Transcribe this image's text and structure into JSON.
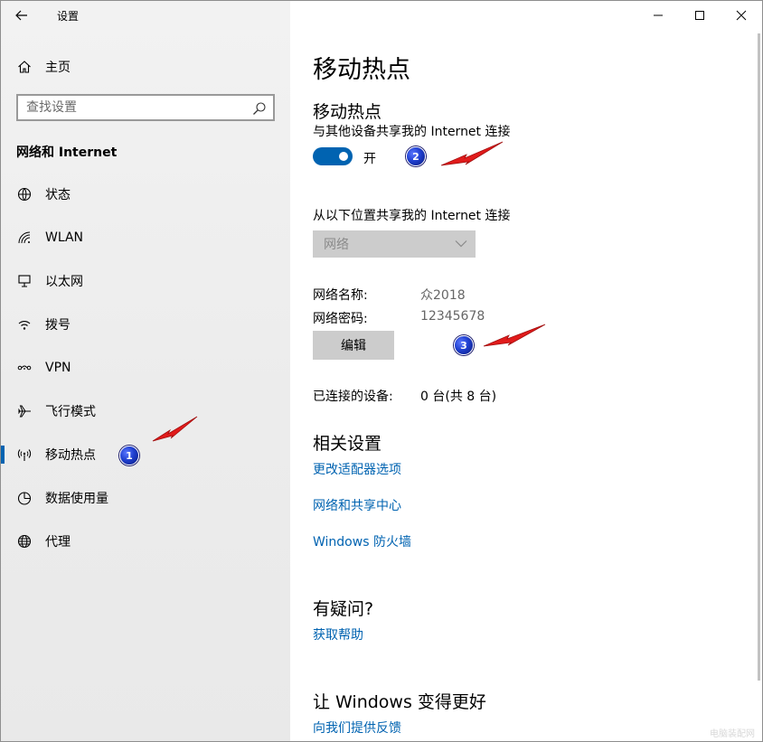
{
  "window": {
    "app_title": "设置"
  },
  "sidebar": {
    "home_label": "主页",
    "search_placeholder": "查找设置",
    "section_title": "网络和 Internet",
    "items": [
      {
        "label": "状态",
        "icon": "status-icon"
      },
      {
        "label": "WLAN",
        "icon": "wifi-icon"
      },
      {
        "label": "以太网",
        "icon": "ethernet-icon"
      },
      {
        "label": "拨号",
        "icon": "dialup-icon"
      },
      {
        "label": "VPN",
        "icon": "vpn-icon"
      },
      {
        "label": "飞行模式",
        "icon": "airplane-icon"
      },
      {
        "label": "移动热点",
        "icon": "hotspot-icon",
        "active": true
      },
      {
        "label": "数据使用量",
        "icon": "data-usage-icon"
      },
      {
        "label": "代理",
        "icon": "globe-icon"
      }
    ]
  },
  "main": {
    "page_title": "移动热点",
    "hotspot_heading": "移动热点",
    "share_desc": "与其他设备共享我的 Internet 连接",
    "toggle_state": "开",
    "share_from_label": "从以下位置共享我的 Internet 连接",
    "share_from_value": "网络",
    "network_name_label": "网络名称:",
    "network_name_value": "众2018",
    "network_password_label": "网络密码:",
    "network_password_value": "12345678",
    "edit_button": "编辑",
    "connected_label": "已连接的设备:",
    "connected_value": "0 台(共 8 台)",
    "related_heading": "相关设置",
    "related_links": [
      "更改适配器选项",
      "网络和共享中心",
      "Windows 防火墙"
    ],
    "question_heading": "有疑问?",
    "help_link": "获取帮助",
    "improve_heading": "让 Windows 变得更好",
    "feedback_link": "向我们提供反馈"
  },
  "annotations": {
    "marker_1": "1",
    "marker_2": "2",
    "marker_3": "3",
    "arrow_color": "#e11b1b"
  },
  "watermark": "电脑装配网",
  "colors": {
    "accent": "#0063b1",
    "sidebar_bg": "#f0f0f0",
    "button_bg": "#cccccc"
  }
}
